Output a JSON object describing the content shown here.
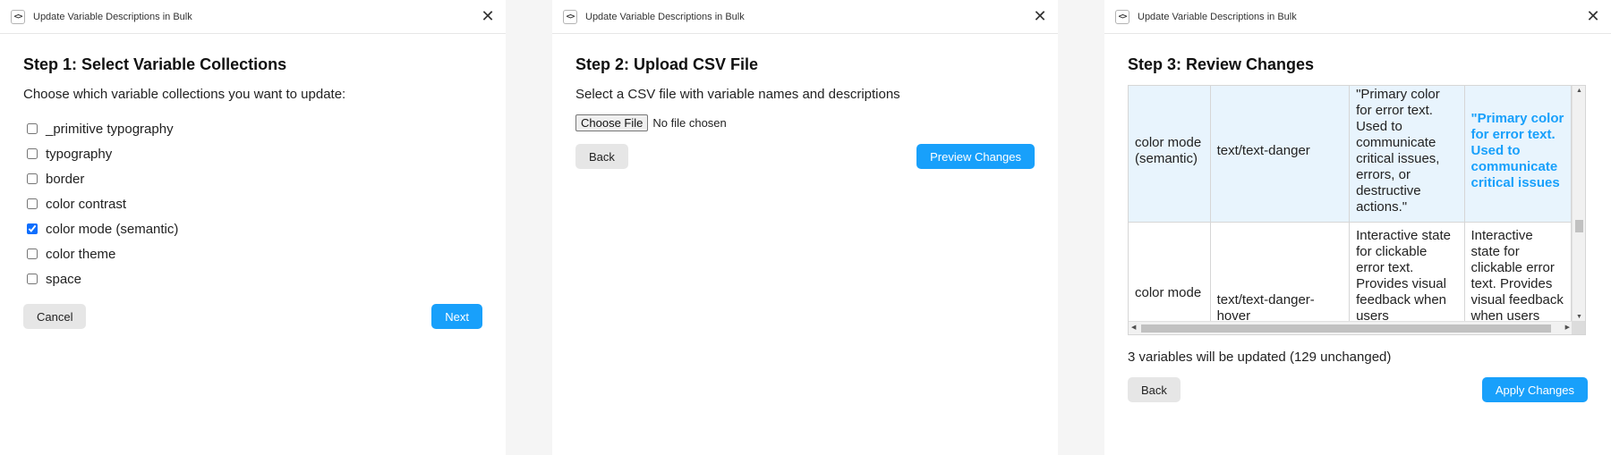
{
  "window_title": "Update Variable Descriptions in Bulk",
  "icons": {
    "plugin": "code-brackets-icon",
    "close": "close-icon"
  },
  "colors": {
    "accent": "#18a0fb",
    "secondary_button": "#e6e6e6",
    "highlight_row": "#e8f4fd"
  },
  "step1": {
    "heading": "Step 1: Select Variable Collections",
    "prompt": "Choose which variable collections you want to update:",
    "collections": [
      {
        "label": "_primitive typography",
        "checked": false
      },
      {
        "label": "typography",
        "checked": false
      },
      {
        "label": "border",
        "checked": false
      },
      {
        "label": "color contrast",
        "checked": false
      },
      {
        "label": "color mode (semantic)",
        "checked": true
      },
      {
        "label": "color theme",
        "checked": false
      },
      {
        "label": "space",
        "checked": false
      }
    ],
    "cancel_label": "Cancel",
    "next_label": "Next"
  },
  "step2": {
    "heading": "Step 2: Upload CSV File",
    "prompt": "Select a CSV file with variable names and descriptions",
    "choose_file_label": "Choose File",
    "file_status": "No file chosen",
    "back_label": "Back",
    "preview_label": "Preview Changes"
  },
  "step3": {
    "heading": "Step 3: Review Changes",
    "rows": [
      {
        "collection": "color mode (semantic)",
        "variable": "text/text-danger",
        "old_description": "\"Primary color for error text. Used to communicate critical issues, errors, or destructive actions.\"",
        "new_description": "\"Primary color for error text. Used to communicate critical issues"
      },
      {
        "collection": "color mode",
        "variable": "text/text-danger-hover",
        "old_description": "Interactive state for clickable error text. Provides visual feedback when users",
        "new_description": "Interactive state for clickable error text. Provides visual feedback when users"
      }
    ],
    "summary": "3 variables will be updated (129 unchanged)",
    "back_label": "Back",
    "apply_label": "Apply Changes"
  }
}
